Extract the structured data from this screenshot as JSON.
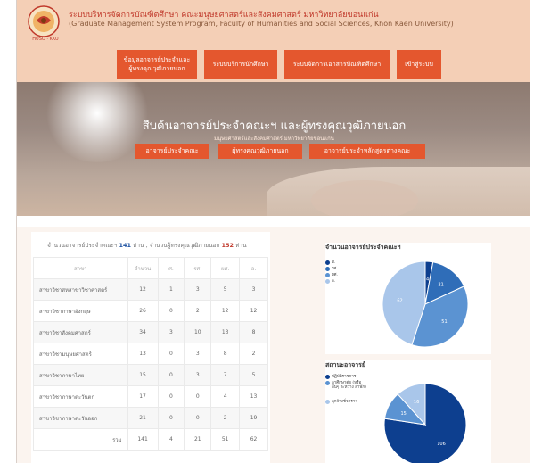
{
  "header": {
    "title": "ระบบบริหารจัดการบัณฑิตศึกษา คณะมนุษยศาสตร์และสังคมศาสตร์ มหาวิทยาลัยขอนแก่น",
    "subtitle": "(Graduate Management System Program, Faculty of Humanities and Social Sciences, Khon Kaen University)",
    "logo_text": "HUSO · KKU"
  },
  "nav": {
    "items": [
      {
        "label": "ข้อมูลอาจารย์ประจำและผู้ทรงคุณวุฒิภายนอก"
      },
      {
        "label": "ระบบบริการนักศึกษา"
      },
      {
        "label": "ระบบจัดการเอกสารบัณฑิตศึกษา"
      },
      {
        "label": "เข้าสู่ระบบ"
      }
    ]
  },
  "hero": {
    "title": "สืบค้นอาจารย์ประจำคณะฯ และผู้ทรงคุณวุฒิภายนอก",
    "subtitle": "มนุษยศาสตร์และสังคมศาสตร์ มหาวิทยาลัยขอนแก่น",
    "buttons": [
      {
        "label": "อาจารย์ประจำคณะ"
      },
      {
        "label": "ผู้ทรงคุณวุฒิภายนอก"
      },
      {
        "label": "อาจารย์ประจำหลักสูตรต่างคณะ"
      }
    ]
  },
  "summary": {
    "prefix": "จำนวนอาจารย์ประจำคณะฯ",
    "faculty_count": "141",
    "mid": "ท่าน , จำนวนผู้ทรงคุณวุฒิภายนอก",
    "external_count": "152",
    "suffix": "ท่าน"
  },
  "table": {
    "headers": [
      "สาขา",
      "จำนวน",
      "ศ.",
      "รศ.",
      "ผศ.",
      "อ."
    ],
    "rows": [
      [
        "สาขาวิชาสหสาขาวิชาศาสตร์",
        "12",
        "1",
        "3",
        "5",
        "3"
      ],
      [
        "สาขาวิชาภาษาอังกฤษ",
        "26",
        "0",
        "2",
        "12",
        "12"
      ],
      [
        "สาขาวิชาสังคมศาสตร์",
        "34",
        "3",
        "10",
        "13",
        "8"
      ],
      [
        "สาขาวิชามนุษยศาสตร์",
        "13",
        "0",
        "3",
        "8",
        "2"
      ],
      [
        "สาขาวิชาภาษาไทย",
        "15",
        "0",
        "3",
        "7",
        "5"
      ],
      [
        "สาขาวิชาภาษาตะวันตก",
        "17",
        "0",
        "0",
        "4",
        "13"
      ],
      [
        "สาขาวิชาภาษาตะวันออก",
        "21",
        "0",
        "0",
        "2",
        "19"
      ]
    ],
    "total_row": [
      "รวม",
      "141",
      "4",
      "21",
      "51",
      "62"
    ]
  },
  "chart_data": [
    {
      "type": "pie",
      "title": "จำนวนอาจารย์ประจำคณะฯ",
      "categories": [
        "ศ.",
        "รศ.",
        "ผศ.",
        "อ."
      ],
      "values": [
        4,
        21,
        51,
        62
      ],
      "colors": [
        "#0d3f8f",
        "#2f6db8",
        "#5b93d2",
        "#a9c6ea"
      ],
      "legend": "top-left"
    },
    {
      "type": "pie",
      "title": "สถานะอาจารย์",
      "categories": [
        "ปฏิบัติราชการ",
        "ลาศึกษาต่อ (หรือ อื่นๆ ระหว่าง ลาพัก)",
        "ลูกจ้างชั่วคราว"
      ],
      "values": [
        106,
        15,
        16
      ],
      "colors": [
        "#0d3f8f",
        "#5b93d2",
        "#a9c6ea"
      ],
      "legend": "top-left"
    }
  ]
}
